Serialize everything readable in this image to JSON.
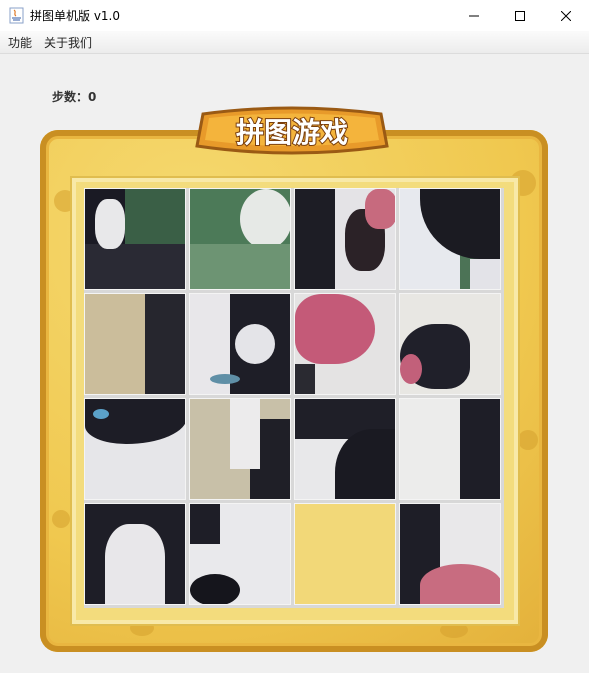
{
  "window": {
    "title": "拼图单机版 v1.0"
  },
  "menu": [
    "功能",
    "关于我们"
  ],
  "game": {
    "steps_label": "步数：",
    "steps": "0",
    "banner_title": "拼图游戏",
    "grid_size": 4,
    "empty_tile": [
      3,
      2
    ]
  }
}
